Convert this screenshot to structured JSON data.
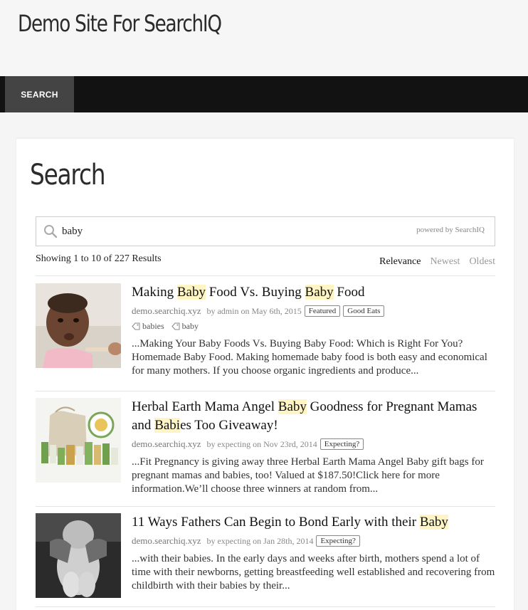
{
  "site": {
    "title": "Demo Site For SearchIQ"
  },
  "nav": {
    "items": [
      {
        "label": "SEARCH"
      }
    ]
  },
  "page": {
    "title": "Search"
  },
  "search": {
    "value": "baby",
    "powered_by": "powered by SearchIQ"
  },
  "results_info": "Showing 1 to 10 of 227 Results",
  "sort": {
    "options": [
      "Relevance",
      "Newest",
      "Oldest"
    ],
    "active": "Relevance"
  },
  "results": [
    {
      "title_parts": [
        "Making ",
        "Baby",
        " Food Vs. Buying ",
        "Baby",
        " Food"
      ],
      "domain": "demo.searchiq.xyz",
      "byline": "by admin on May 6th, 2015",
      "categories": [
        "Featured",
        "Good Eats"
      ],
      "tags": [
        "babies",
        "baby"
      ],
      "snippet": "...Making Your Baby Foods Vs. Buying Baby Food: Which is Right For You? Homemade Baby Food. Making homemade baby food is both easy and economical for many mothers. If you choose organic ingredients and produce..."
    },
    {
      "title_parts": [
        "Herbal Earth Mama Angel ",
        "Baby",
        " Goodness for Pregnant Mamas and ",
        "Babi",
        "es Too Giveaway!"
      ],
      "domain": "demo.searchiq.xyz",
      "byline": "by expecting on Nov 23rd, 2014",
      "categories": [
        "Expecting?"
      ],
      "tags": [],
      "snippet": "...Fit Pregnancy is giving away three Herbal Earth Mama Angel Baby gift bags for pregnant mamas and babies, too! Valued at $187.50!Click here for more information.We’ll choose three winners at random from..."
    },
    {
      "title_parts": [
        "11 Ways Fathers Can Begin to Bond Early with their ",
        "Baby"
      ],
      "domain": "demo.searchiq.xyz",
      "byline": "by expecting on Jan 28th, 2014",
      "categories": [
        "Expecting?"
      ],
      "tags": [],
      "snippet": "...with their babies. In the early days and weeks after birth, mothers spend a lot of time with their newborns, getting breastfeeding well established and recovering from childbirth with their babies by their..."
    }
  ]
}
